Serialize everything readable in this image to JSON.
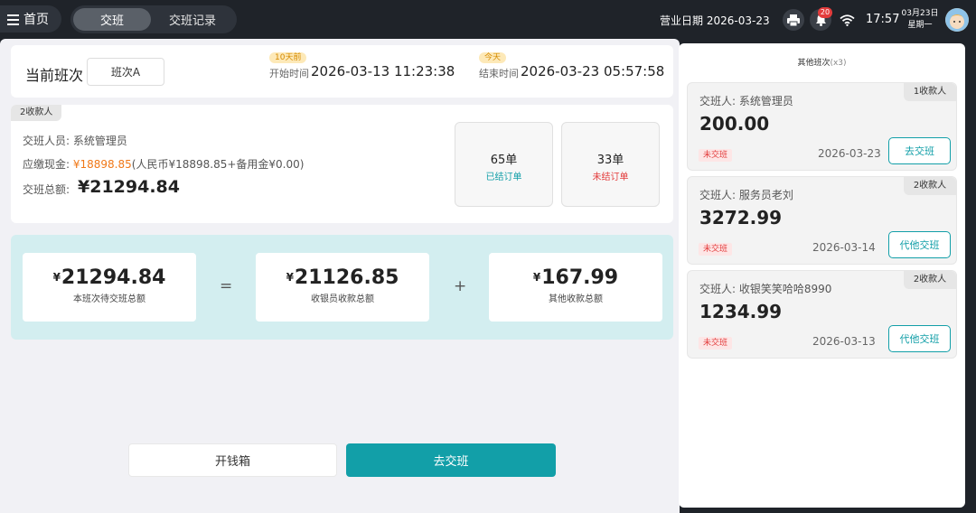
{
  "topbar": {
    "home_label": "首页",
    "tabs": [
      {
        "label": "交班",
        "active": true
      },
      {
        "label": "交班记录",
        "active": false
      }
    ],
    "business_date_label": "营业日期",
    "business_date": "2026-03-23",
    "notification_count": "20",
    "time": "17:57",
    "date_short": "03月23日",
    "weekday": "星期一",
    "icons": [
      "printer-icon",
      "bell-icon",
      "wifi-icon",
      "avatar"
    ]
  },
  "shift": {
    "label": "当前班次",
    "selected": "班次A",
    "start_tag": "10天前",
    "start_label": "开始时间",
    "start_time": "2026-03-13 11:23:38",
    "end_tag": "今天",
    "end_label": "结束时间",
    "end_time": "2026-03-23 05:57:58"
  },
  "info": {
    "cashier_count_tag": "2收款人",
    "handover_person_label": "交班人员:",
    "handover_person": "系统管理员",
    "cash_due_label": "应缴现金:",
    "cash_due": "¥18898.85",
    "cash_due_detail": "(人民币¥18898.85+备用金¥0.00)",
    "total_label": "交班总额:",
    "total": "¥21294.84",
    "settled_count": "65单",
    "settled_label": "已结订单",
    "unsettled_count": "33单",
    "unsettled_label": "未结订单"
  },
  "formula": {
    "yen": "¥",
    "total_amount": "21294.84",
    "total_desc": "本班次待交班总额",
    "eq": "=",
    "cashier_amount": "21126.85",
    "cashier_desc": "收银员收款总额",
    "plus": "+",
    "other_amount": "167.99",
    "other_desc": "其他收款总额"
  },
  "buttons": {
    "open_cash_drawer": "开钱箱",
    "go_handover": "去交班"
  },
  "sidebar": {
    "title": "其他班次",
    "title_count": "(x3)",
    "cards": [
      {
        "person_label": "交班人:",
        "person": "系统管理员",
        "amount": "200.00",
        "status": "未交班",
        "date": "2026-03-23",
        "tag": "1收款人",
        "button": "去交班"
      },
      {
        "person_label": "交班人:",
        "person": "服务员老刘",
        "amount": "3272.99",
        "status": "未交班",
        "date": "2026-03-14",
        "tag": "2收款人",
        "button": "代他交班"
      },
      {
        "person_label": "交班人:",
        "person": "收银笑笑哈哈8990",
        "amount": "1234.99",
        "status": "未交班",
        "date": "2026-03-13",
        "tag": "2收款人",
        "button": "代他交班"
      }
    ]
  },
  "colors": {
    "accent": "#129fa8",
    "orange": "#f07818",
    "red": "#e33c3c",
    "topbar": "#1f2329"
  }
}
